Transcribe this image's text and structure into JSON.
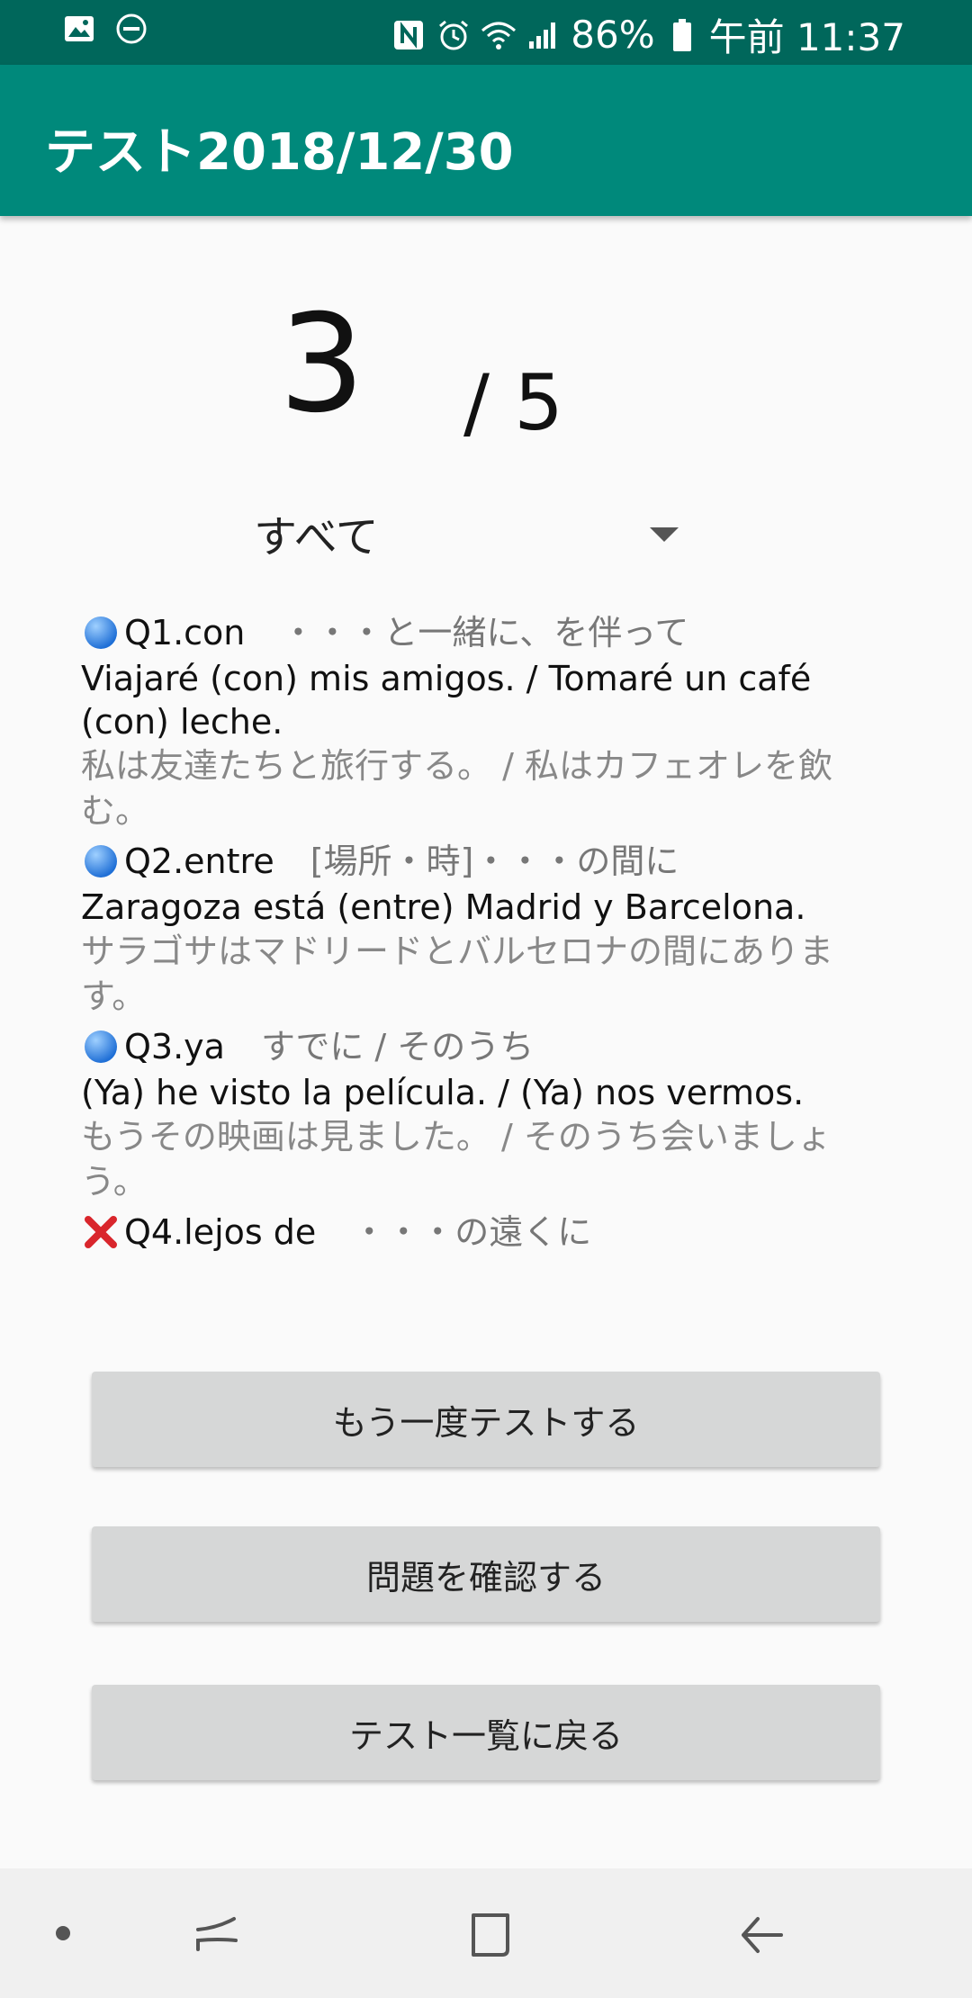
{
  "status_bar": {
    "left_icons": [
      "image-icon",
      "do-not-disturb-icon"
    ],
    "right_icons": [
      "nfc-icon",
      "alarm-icon",
      "wifi-icon",
      "signal-icon"
    ],
    "battery": "86%",
    "time": "午前 11:37"
  },
  "app_bar": {
    "title": "テスト2018/12/30"
  },
  "score": {
    "correct": "3",
    "total": "/ 5"
  },
  "filter": {
    "selected": "すべて"
  },
  "questions": [
    {
      "mark": "correct",
      "word": "Q1.con",
      "meaning": "・・・と一緒に、を伴って",
      "example_es": "Viajaré (con) mis amigos. / Tomaré un café (con) leche.",
      "example_ja": "私は友達たちと旅行する。 / 私はカフェオレを飲む。"
    },
    {
      "mark": "correct",
      "word": "Q2.entre",
      "meaning": "[場所・時]・・・の間に",
      "example_es": "Zaragoza está (entre) Madrid y Barcelona.",
      "example_ja": "サラゴサはマドリードとバルセロナの間にあります。"
    },
    {
      "mark": "correct",
      "word": "Q3.ya",
      "meaning": "すでに / そのうち",
      "example_es": "(Ya) he visto la película. / (Ya) nos vermos.",
      "example_ja": "もうその映画は見ました。 / そのうち会いましょう。"
    },
    {
      "mark": "wrong",
      "word": "Q4.lejos de",
      "meaning": "・・・の遠くに",
      "example_es": "",
      "example_ja": ""
    }
  ],
  "buttons": {
    "retry": "もう一度テストする",
    "review": "問題を確認する",
    "back": "テスト一覧に戻る"
  },
  "colors": {
    "status_bar": "#00675b",
    "app_bar": "#00897b",
    "button_bg": "#d6d7d7",
    "correct_mark": "#2f7de1",
    "wrong_mark": "#d9262c"
  }
}
